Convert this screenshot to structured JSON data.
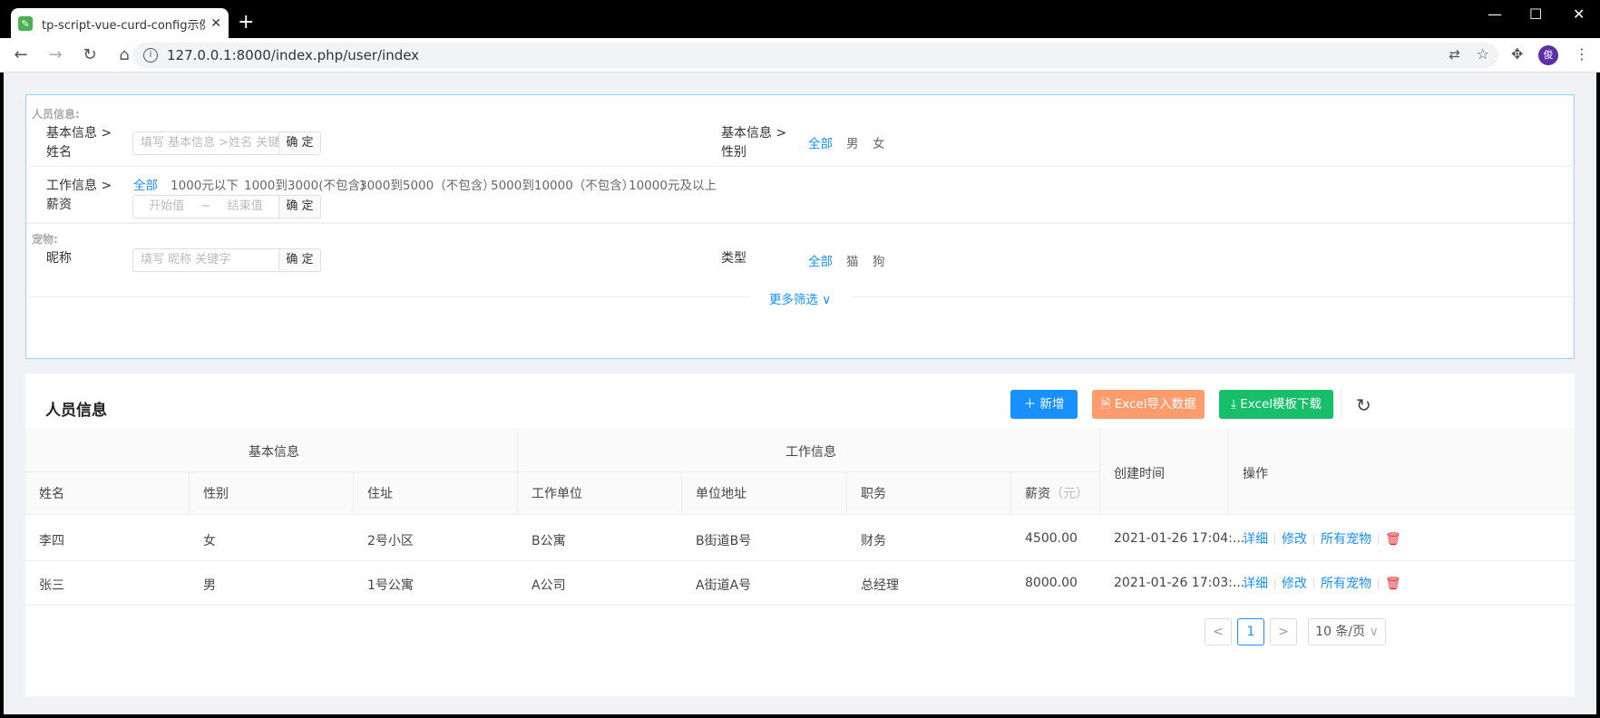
{
  "browser": {
    "tab_title": "tp-script-vue-curd-config示例",
    "url": "127.0.0.1:8000/index.php/user/index",
    "avatar": "俊"
  },
  "filter": {
    "group1": "人员信息:",
    "name_label": "基本信息 >姓名",
    "name_placeholder": "填写 基本信息 >姓名 关键...",
    "ok": "确 定",
    "sex_label": "基本信息 >性别",
    "sex_options": [
      "全部",
      "男",
      "女"
    ],
    "salary_label": "工作信息 >薪资",
    "salary_options": [
      "全部",
      "1000元以下",
      "1000到3000(不包含)",
      "3000到5000（不包含）",
      "5000到10000（不包含）",
      "10000元及以上"
    ],
    "salary_start": "开始值",
    "salary_sep": "~",
    "salary_end": "结束值",
    "group2": "宠物:",
    "nick_label": "昵称",
    "nick_placeholder": "填写 昵称 关键字",
    "type_label": "类型",
    "type_options": [
      "全部",
      "猫",
      "狗"
    ],
    "more": "更多筛选 ∨"
  },
  "card": {
    "title": "人员信息",
    "add_btn": "新增",
    "import_btn": "Excel导入数据",
    "download_btn": "Excel模板下载",
    "colors": {
      "add": "#1890ff",
      "import": "#ff9c6e",
      "download": "#19be6b"
    }
  },
  "table": {
    "group_headers": [
      "基本信息",
      "工作信息"
    ],
    "created_header": "创建时间",
    "op_header": "操作",
    "columns": [
      "姓名",
      "性别",
      "住址",
      "工作单位",
      "单位地址",
      "职务",
      "薪资"
    ],
    "salary_unit": "（元）",
    "rows": [
      {
        "name": "李四",
        "sex": "女",
        "addr": "2号小区",
        "company": "B公寓",
        "company_addr": "B街道B号",
        "post": "财务",
        "salary": "4500.00",
        "created": "2021-01-26 17:04:..."
      },
      {
        "name": "张三",
        "sex": "男",
        "addr": "1号公寓",
        "company": "A公司",
        "company_addr": "A街道A号",
        "post": "总经理",
        "salary": "8000.00",
        "created": "2021-01-26 17:03:..."
      }
    ],
    "actions": [
      "详细",
      "修改",
      "所有宠物"
    ]
  },
  "pagination": {
    "prev": "<",
    "page": "1",
    "next": ">",
    "size": "10 条/页"
  }
}
